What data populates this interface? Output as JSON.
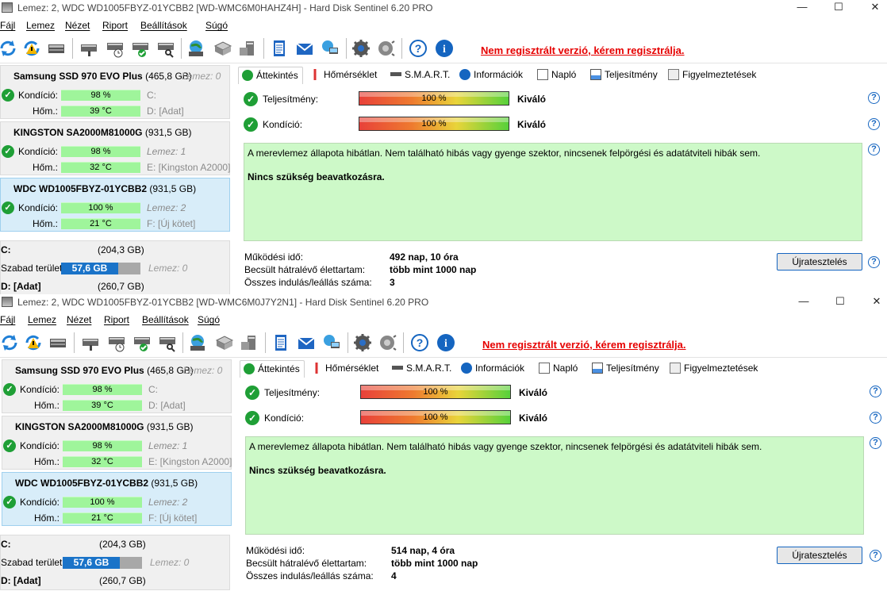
{
  "windows": [
    {
      "title": "Lemez: 2, WDC WD1005FBYZ-01YCBB2 [WD-WMC6M0HAHZ4H]  -  Hard Disk Sentinel 6.20 PRO",
      "menu": [
        "Fájl",
        "Lemez",
        "Nézet",
        "Riport",
        "Beállítások",
        "Súgó"
      ],
      "unregistered": "Nem regisztrált verzió, kérem regisztrálja.",
      "disks": [
        {
          "name": "Samsung SSD 970 EVO Plus",
          "size": "(465,8 GB)",
          "lemez": "Lemez: 0",
          "kondicio_label": "Kondíció:",
          "kondicio": "98 %",
          "drive1": "C:",
          "hom_label": "Hőm.:",
          "hom": "39 °C",
          "drive2": "D: [Adat]"
        },
        {
          "name": "KINGSTON SA2000M81000G",
          "size": "(931,5 GB)",
          "lemez": "",
          "kondicio_label": "Kondíció:",
          "kondicio": "98 %",
          "drive1": "Lemez: 1",
          "hom_label": "Hőm.:",
          "hom": "32 °C",
          "drive2": "E: [Kingston A2000]"
        },
        {
          "name": "WDC WD1005FBYZ-01YCBB2",
          "size": "(931,5 GB)",
          "lemez": "",
          "kondicio_label": "Kondíció:",
          "kondicio": "100 %",
          "drive1": "Lemez: 2",
          "hom_label": "Hőm.:",
          "hom": "21 °C",
          "drive2": "F: [Új kötet]"
        }
      ],
      "volume": {
        "c_label": "C:",
        "c_size": "(204,3 GB)",
        "free_label": "Szabad terület",
        "free": "57,6 GB",
        "free_lemez": "Lemez: 0",
        "d_label": "D: [Adat]",
        "d_size": "(260,7 GB)"
      },
      "tabs": [
        "Áttekintés",
        "Hőmérséklet",
        "S.M.A.R.T.",
        "Információk",
        "Napló",
        "Teljesítmény",
        "Figyelmeztetések"
      ],
      "teljesitmeny_label": "Teljesítmény:",
      "teljesitmeny": "100 %",
      "teljesitmeny_text": "Kiváló",
      "kondicio_label": "Kondíció:",
      "kondicio": "100 %",
      "kondicio_text": "Kiváló",
      "status_text": "A merevlemez állapota hibátlan. Nem található hibás vagy gyenge szektor, nincsenek felpörgési és adatátviteli hibák sem.",
      "status_bold": "Nincs szükség beavatkozásra.",
      "info": [
        {
          "label": "Működési idő:",
          "value": "492 nap, 10 óra"
        },
        {
          "label": "Becsült hátralévő élettartam:",
          "value": "több mint 1000 nap"
        },
        {
          "label": "Összes indulás/leállás száma:",
          "value": "3"
        }
      ],
      "retest": "Újratesztelés"
    },
    {
      "title": "Lemez: 2, WDC WD1005FBYZ-01YCBB2 [WD-WMC6M0J7Y2N1]  -  Hard Disk Sentinel 6.20 PRO",
      "menu": [
        "Fájl",
        "Lemez",
        "Nézet",
        "Riport",
        "Beállítások",
        "Súgó"
      ],
      "unregistered": "Nem regisztrált verzió, kérem regisztrálja.",
      "disks": [
        {
          "name": "Samsung SSD 970 EVO Plus",
          "size": "(465,8 GB)",
          "lemez": "Lemez: 0",
          "kondicio_label": "Kondíció:",
          "kondicio": "98 %",
          "drive1": "C:",
          "hom_label": "Hőm.:",
          "hom": "39 °C",
          "drive2": "D: [Adat]"
        },
        {
          "name": "KINGSTON SA2000M81000G",
          "size": "(931,5 GB)",
          "lemez": "",
          "kondicio_label": "Kondíció:",
          "kondicio": "98 %",
          "drive1": "Lemez: 1",
          "hom_label": "Hőm.:",
          "hom": "32 °C",
          "drive2": "E: [Kingston A2000]"
        },
        {
          "name": "WDC WD1005FBYZ-01YCBB2",
          "size": "(931,5 GB)",
          "lemez": "",
          "kondicio_label": "Kondíció:",
          "kondicio": "100 %",
          "drive1": "Lemez: 2",
          "hom_label": "Hőm.:",
          "hom": "21 °C",
          "drive2": "F: [Új kötet]"
        }
      ],
      "volume": {
        "c_label": "C:",
        "c_size": "(204,3 GB)",
        "free_label": "Szabad terület",
        "free": "57,6 GB",
        "free_lemez": "Lemez: 0",
        "d_label": "D: [Adat]",
        "d_size": "(260,7 GB)"
      },
      "tabs": [
        "Áttekintés",
        "Hőmérséklet",
        "S.M.A.R.T.",
        "Információk",
        "Napló",
        "Teljesítmény",
        "Figyelmeztetések"
      ],
      "teljesitmeny_label": "Teljesítmény:",
      "teljesitmeny": "100 %",
      "teljesitmeny_text": "Kiváló",
      "kondicio_label": "Kondíció:",
      "kondicio": "100 %",
      "kondicio_text": "Kiváló",
      "status_text": "A merevlemez állapota hibátlan. Nem található hibás vagy gyenge szektor, nincsenek felpörgési és adatátviteli hibák sem.",
      "status_bold": "Nincs szükség beavatkozásra.",
      "info": [
        {
          "label": "Működési idő:",
          "value": "514 nap, 4 óra"
        },
        {
          "label": "Becsült hátralévő élettartam:",
          "value": "több mint 1000 nap"
        },
        {
          "label": "Összes indulás/leállás száma:",
          "value": "4"
        }
      ],
      "retest": "Újratesztelés"
    }
  ],
  "colors": {
    "accent": "#1565c0",
    "ok": "#1f9f36",
    "unregistered": "#e60000",
    "status_bg": "#cdf9c8",
    "selected": "#d8edf9"
  },
  "icons": [
    "refresh-icon",
    "warning-refresh-icon",
    "hdd-icon",
    "disk-health-icon",
    "disk-clock-icon",
    "disk-check-icon",
    "disk-search-icon",
    "globe-disk-icon",
    "network-disk-icon",
    "server-icon",
    "notepad-icon",
    "mail-icon",
    "network-icon",
    "gear-icon",
    "speaker-icon",
    "help-icon",
    "info-icon"
  ]
}
